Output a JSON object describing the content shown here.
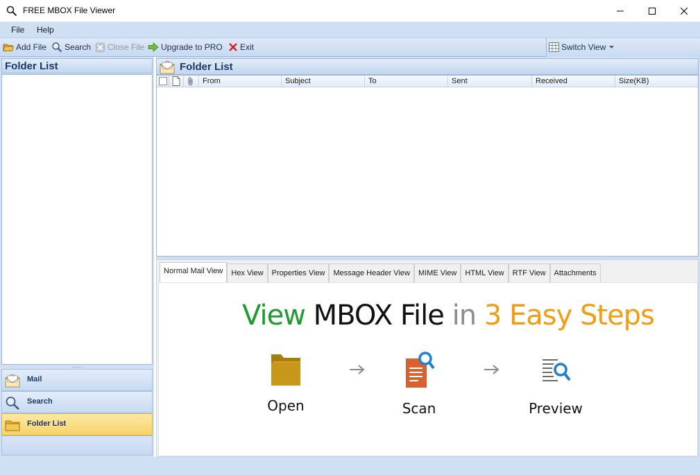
{
  "window": {
    "title": "FREE MBOX File Viewer",
    "app_icon": "search-icon",
    "controls": [
      "minimize-icon",
      "maximize-icon",
      "close-icon"
    ]
  },
  "menu": {
    "items": [
      {
        "label": "File"
      },
      {
        "label": "Help"
      }
    ]
  },
  "toolbar": {
    "add_file": "Add File",
    "search": "Search",
    "close_file": "Close File",
    "upgrade": "Upgrade to PRO",
    "exit": "Exit",
    "switch_view": "Switch View"
  },
  "left_pane": {
    "header": "Folder List",
    "splitter_grip": "......",
    "nav": [
      {
        "label": "Mail",
        "icon": "mail-icon",
        "active": false
      },
      {
        "label": "Search",
        "icon": "search-icon",
        "active": false
      },
      {
        "label": "Folder List",
        "icon": "folder-icon",
        "active": true
      }
    ]
  },
  "right_pane": {
    "header": "Folder List",
    "columns": [
      "From",
      "Subject",
      "To",
      "Sent",
      "Received",
      "Size(KB)"
    ],
    "rows": []
  },
  "preview": {
    "tabs": [
      {
        "label": "Normal Mail View",
        "active": true
      },
      {
        "label": "Hex View",
        "active": false
      },
      {
        "label": "Properties View",
        "active": false
      },
      {
        "label": "Message Header View",
        "active": false
      },
      {
        "label": "MIME View",
        "active": false
      },
      {
        "label": "HTML View",
        "active": false
      },
      {
        "label": "RTF View",
        "active": false
      },
      {
        "label": "Attachments",
        "active": false
      }
    ],
    "headline": {
      "part1": "View",
      "part2": "MBOX File",
      "part3": "in",
      "part4": "3 Easy Steps"
    },
    "steps": [
      {
        "label": "Open",
        "icon": "folder-icon"
      },
      {
        "label": "Scan",
        "icon": "scan-document-icon"
      },
      {
        "label": "Preview",
        "icon": "preview-document-icon"
      }
    ]
  },
  "colors": {
    "chrome": "#cfe0f5",
    "header_text": "#1d3768",
    "green": "#1e9b2e",
    "orange": "#f39c12",
    "gray": "#8e8e8e"
  }
}
